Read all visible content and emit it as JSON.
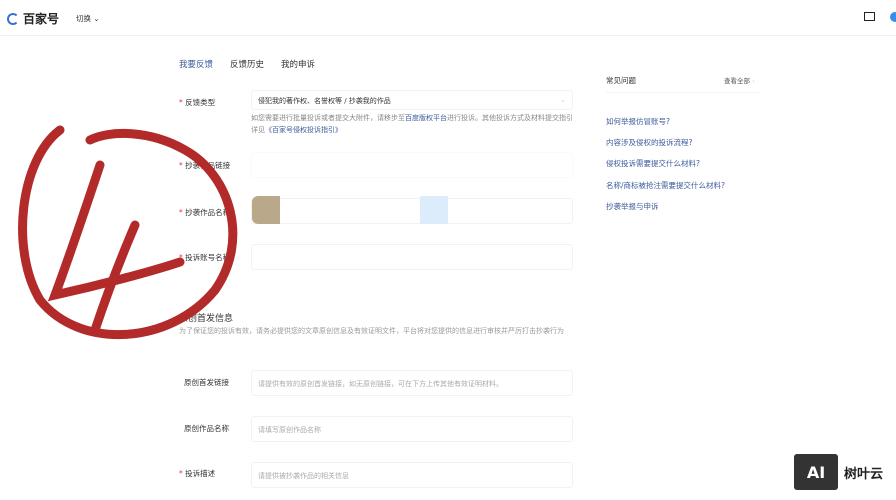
{
  "header": {
    "logo": "百家号",
    "switch": "切换"
  },
  "tabs": [
    "我要反馈",
    "反馈历史",
    "我的申诉"
  ],
  "form": {
    "type_label": "反馈类型",
    "type_value": "侵犯我的著作权、名誉权等 / 抄袭我的作品",
    "hint_pre": "如您需要进行批量投诉或者提交大附件，请移步至",
    "hint_link1": "百度版权平台",
    "hint_mid": "进行投诉。其他投诉方式及材料提交指引详见",
    "hint_link2": "《百家号侵权投诉指引》",
    "copy_link_label": "抄袭作品链接",
    "copy_name_label": "抄袭作品名称",
    "account_label": "投诉账号名称",
    "section_title": "原创首发信息",
    "section_hint": "为了保证您的投诉有效，请务必提供您的文章原创信息及有效证明文件，平台将对您提供的信息进行审核并严厉打击抄袭行为",
    "orig_link_label": "原创首发链接",
    "orig_link_placeholder": "请提供有效的原创首发链接，如无原创链接，可在下方上传其他有效证明材料。",
    "orig_name_label": "原创作品名称",
    "orig_name_placeholder": "请填写原创作品名称",
    "desc_label": "投诉描述",
    "desc_placeholder": "请提供被抄袭作品的相关信息"
  },
  "faq": {
    "title": "常见问题",
    "view_all": "查看全部",
    "items": [
      "如何举报仿冒账号?",
      "内容涉及侵权的投诉流程?",
      "侵权投诉需要提交什么材料?",
      "名称/商标被抢注需要提交什么材料?",
      "抄袭举报与申诉"
    ]
  },
  "annotation": "4",
  "watermark": {
    "logo": "AI",
    "text": "树叶云"
  }
}
